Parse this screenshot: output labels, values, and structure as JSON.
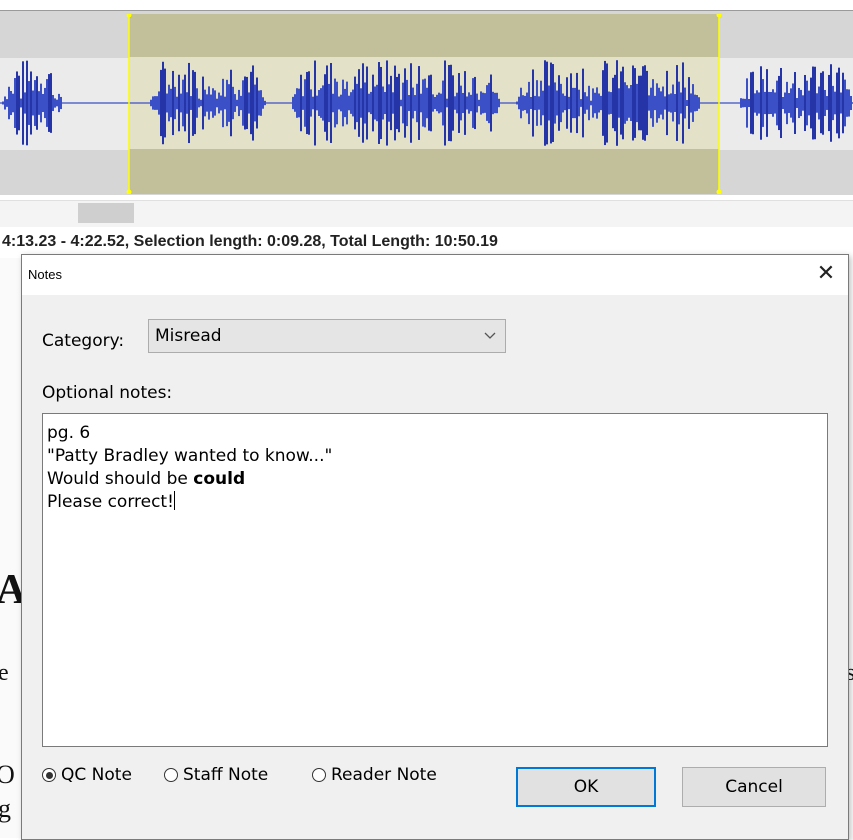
{
  "status": {
    "text": "4:13.23 - 4:22.52, Selection length: 0:09.28, Total Length: 10:50.19"
  },
  "background": {
    "frag_a": "A",
    "frag_e": "e",
    "frag_s": "s",
    "frag_o": "O",
    "frag_g": "g"
  },
  "dialog": {
    "title": "Notes",
    "close_glyph": "✕",
    "category_label": "Category:",
    "category_value": "Misread",
    "notes_label": "Optional notes:",
    "notes": {
      "line1": "pg. 6",
      "line2": "\"Patty Bradley wanted to know...\"",
      "line3_prefix": "Would should be ",
      "line3_bold": "could",
      "line4": "Please correct!"
    },
    "radios": {
      "qc": "QC Note",
      "staff": "Staff Note",
      "reader": "Reader Note",
      "selected": "QC Note"
    },
    "ok_label": "OK",
    "cancel_label": "Cancel"
  },
  "colors": {
    "waveform": "#3b4fc7",
    "waveform_dark": "#2535a8",
    "selection": "#c2c09a",
    "selection_handle": "#ffff00",
    "ok_focus": "#0078d7"
  },
  "icons": {
    "close": "close-icon",
    "dropdown": "chevron-down-icon",
    "radio_selected": "radio-selected-icon",
    "radio_unselected": "radio-unselected-icon"
  }
}
